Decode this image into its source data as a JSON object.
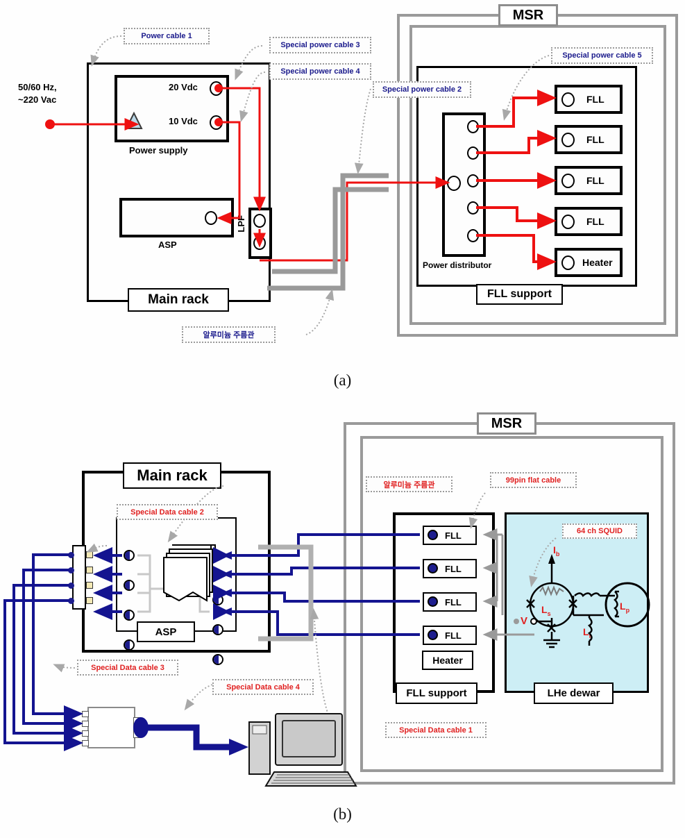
{
  "figure": {
    "caption_a": "(a)",
    "caption_b": "(b)"
  },
  "panel_a": {
    "msr_label": "MSR",
    "mains_label_line1": "50/60 Hz,",
    "mains_label_line2": "~220 Vac",
    "power_supply": {
      "title": "Power supply",
      "out_20v": "20 Vdc",
      "out_10v": "10 Vdc"
    },
    "asp_label": "ASP",
    "lpf_label": "LPF",
    "main_rack_label": "Main rack",
    "power_distributor_label": "Power distributor",
    "fll_support_label": "FLL support",
    "fll_modules": [
      "FLL",
      "FLL",
      "FLL",
      "FLL"
    ],
    "heater_label": "Heater",
    "callouts": [
      "Power cable 1",
      "Special power cable 3",
      "Special power cable 4",
      "Special power cable 2",
      "Special power cable 5",
      "알루미늄 주름관"
    ]
  },
  "panel_b": {
    "msr_label": "MSR",
    "main_rack_label": "Main rack",
    "asp_label": "ASP",
    "fll_support_label": "FLL support",
    "heater_label": "Heater",
    "lhe_dewar_label": "LHe dewar",
    "fll_modules": [
      "FLL",
      "FLL",
      "FLL",
      "FLL"
    ],
    "squid": {
      "title": "64 ch SQUID",
      "bias_current": "I",
      "bias_current_sub": "b",
      "voltage": "V",
      "ls": "L",
      "ls_sub": "s",
      "li": "L",
      "li_sub": "i",
      "lp": "L",
      "lp_sub": "p"
    },
    "callouts": [
      "Special Data cable 2",
      "Special Data cable 3",
      "Special Data cable 4",
      "Special Data cable 1",
      "알루미늄 주름관",
      "99pin flat cable"
    ]
  },
  "colors": {
    "red_wire": "#ee1111",
    "blue_wire": "#141490",
    "gray_conduit": "#9a9a9a",
    "squid_fill": "#cdeef5",
    "callout_blue": "#1a1a8c",
    "callout_red": "#e02020"
  }
}
